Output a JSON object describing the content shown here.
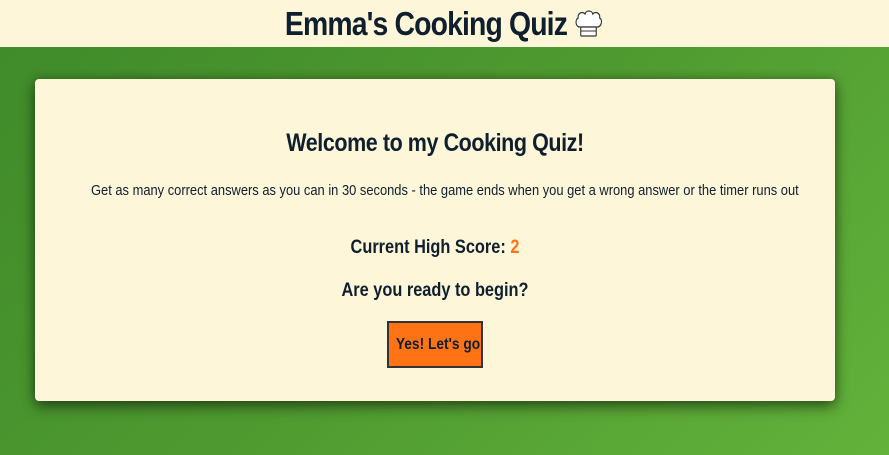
{
  "header": {
    "title": "Emma's Cooking Quiz",
    "icon": "chef-hat-icon"
  },
  "card": {
    "welcome": "Welcome to my Cooking Quiz!",
    "instructions": "Get as many correct answers as you can in 30 seconds - the game ends when you get a wrong answer or the timer runs out",
    "high_score_label": "Current High Score:",
    "high_score_value": "2",
    "ready_prompt": "Are you ready to begin?",
    "start_button_label": "Yes! Let's go"
  },
  "colors": {
    "header_background": "#fdf6d9",
    "card_background": "#fdf6d9",
    "accent_orange": "#ff7314",
    "text_dark": "#0f1f2e",
    "page_green": "#4f9a30"
  }
}
